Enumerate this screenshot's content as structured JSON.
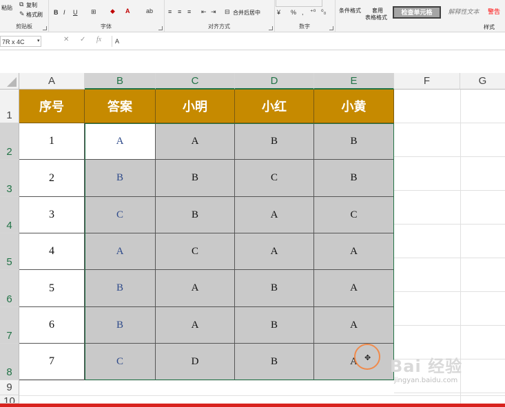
{
  "ribbon": {
    "clipboard": {
      "copy": "复制",
      "format_painter": "格式刷",
      "paste": "粘贴",
      "label": "剪贴板"
    },
    "font": {
      "label": "字体"
    },
    "alignment": {
      "merge_center": "合并后居中",
      "label": "对齐方式"
    },
    "number": {
      "label": "数字"
    },
    "styles": {
      "conditional_format": "条件格式",
      "format_as_table_1": "套用",
      "format_as_table_2": "表格格式",
      "check_cell": "检查单元格",
      "explanatory_text": "解释性文本",
      "warning": "警告",
      "label": "样式"
    }
  },
  "formula_bar": {
    "name_box": "7R x 4C",
    "fx": "fx",
    "content": "A"
  },
  "columns": [
    "A",
    "B",
    "C",
    "D",
    "E",
    "F",
    "G"
  ],
  "rows": [
    "1",
    "2",
    "3",
    "4",
    "5",
    "6",
    "7",
    "8",
    "9",
    "10"
  ],
  "table": {
    "headers": [
      "序号",
      "答案",
      "小明",
      "小红",
      "小黄"
    ],
    "rows": [
      [
        "1",
        "A",
        "A",
        "B",
        "B"
      ],
      [
        "2",
        "B",
        "B",
        "C",
        "B"
      ],
      [
        "3",
        "C",
        "B",
        "A",
        "C"
      ],
      [
        "4",
        "A",
        "C",
        "A",
        "A"
      ],
      [
        "5",
        "B",
        "A",
        "B",
        "A"
      ],
      [
        "6",
        "B",
        "A",
        "B",
        "A"
      ],
      [
        "7",
        "C",
        "D",
        "B",
        "A"
      ]
    ]
  },
  "watermark": {
    "brand": "Bai 经验",
    "url": "jingyan.baidu.com"
  },
  "colors": {
    "header_fill": "#c68a00",
    "selection_fill": "#c9c9c9",
    "selection_border": "#217346",
    "answer_text": "#2e4a8a"
  }
}
